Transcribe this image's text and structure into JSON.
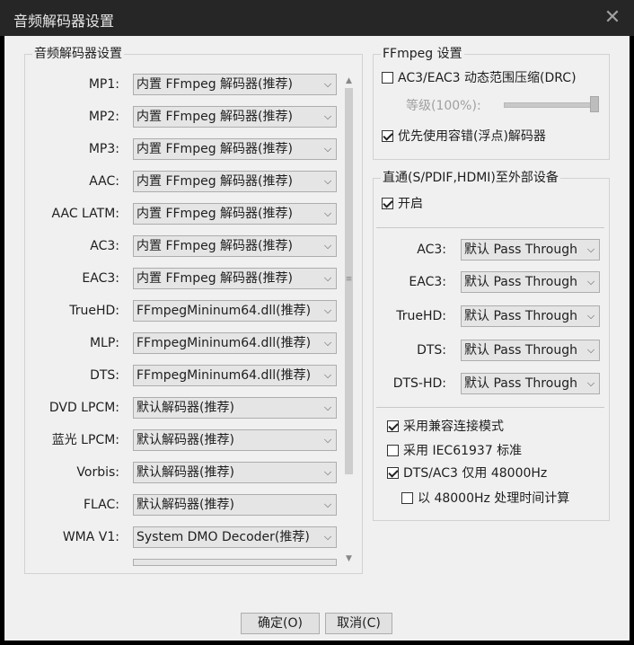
{
  "window": {
    "title": "音频解码器设置",
    "close_glyph": "✕"
  },
  "decoder_group": {
    "legend": "音频解码器设置",
    "rows": [
      {
        "label": "MP1:",
        "value": "内置 FFmpeg 解码器(推荐)"
      },
      {
        "label": "MP2:",
        "value": "内置 FFmpeg 解码器(推荐)"
      },
      {
        "label": "MP3:",
        "value": "内置 FFmpeg 解码器(推荐)"
      },
      {
        "label": "AAC:",
        "value": "内置 FFmpeg 解码器(推荐)"
      },
      {
        "label": "AAC LATM:",
        "value": "内置 FFmpeg 解码器(推荐)"
      },
      {
        "label": "AC3:",
        "value": "内置 FFmpeg 解码器(推荐)"
      },
      {
        "label": "EAC3:",
        "value": "内置 FFmpeg 解码器(推荐)"
      },
      {
        "label": "TrueHD:",
        "value": "FFmpegMininum64.dll(推荐)"
      },
      {
        "label": "MLP:",
        "value": "FFmpegMininum64.dll(推荐)"
      },
      {
        "label": "DTS:",
        "value": "FFmpegMininum64.dll(推荐)"
      },
      {
        "label": "DVD LPCM:",
        "value": "默认解码器(推荐)"
      },
      {
        "label": "蓝光 LPCM:",
        "value": "默认解码器(推荐)"
      },
      {
        "label": "Vorbis:",
        "value": "默认解码器(推荐)"
      },
      {
        "label": "FLAC:",
        "value": "默认解码器(推荐)"
      },
      {
        "label": "WMA V1:",
        "value": "System DMO Decoder(推荐)"
      }
    ],
    "arrow_glyph": "⌵"
  },
  "ffmpeg_group": {
    "legend": "FFmpeg 设置",
    "drc_label": "AC3/EAC3 动态范围压缩(DRC)",
    "drc_checked": false,
    "level_label": "等级(100%):",
    "level_value": 1.0,
    "prefer_error_label": "优先使用容错(浮点)解码器",
    "prefer_error_checked": true
  },
  "passthrough_group": {
    "legend": "直通(S/PDIF,HDMI)至外部设备",
    "enable_label": "开启",
    "enable_checked": true,
    "rows": [
      {
        "label": "AC3:",
        "value": "默认 Pass Through"
      },
      {
        "label": "EAC3:",
        "value": "默认 Pass Through"
      },
      {
        "label": "TrueHD:",
        "value": "默认 Pass Through"
      },
      {
        "label": "DTS:",
        "value": "默认 Pass Through"
      },
      {
        "label": "DTS-HD:",
        "value": "默认 Pass Through"
      }
    ],
    "compat_label": "采用兼容连接模式",
    "compat_checked": true,
    "iec_label": "采用 IEC61937 标准",
    "iec_checked": false,
    "dts_ac3_label": "DTS/AC3 仅用 48000Hz",
    "dts_ac3_checked": true,
    "timing_label": "以 48000Hz 处理时间计算",
    "timing_checked": false
  },
  "buttons": {
    "ok": "确定(O)",
    "cancel": "取消(C)"
  },
  "scrollbar": {
    "up": "▲",
    "down": "▼",
    "grip": "≡"
  }
}
